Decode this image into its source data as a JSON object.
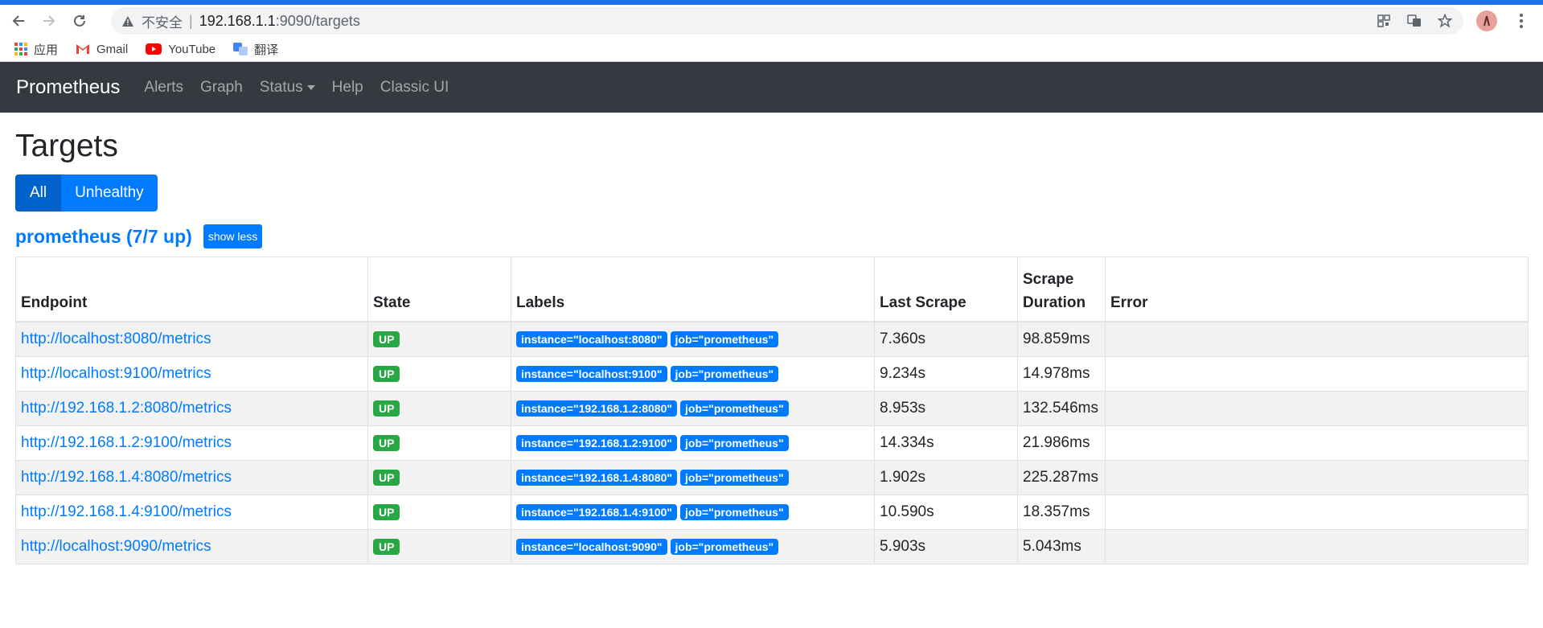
{
  "browser": {
    "insecure_label": "不安全",
    "url_host": "192.168.1.1",
    "url_rest": ":9090/targets",
    "bookmarks": [
      {
        "label": "应用"
      },
      {
        "label": "Gmail"
      },
      {
        "label": "YouTube"
      },
      {
        "label": "翻译"
      }
    ]
  },
  "navbar": {
    "brand": "Prometheus",
    "links": [
      "Alerts",
      "Graph",
      "Status",
      "Help",
      "Classic UI"
    ]
  },
  "page": {
    "title": "Targets",
    "filters": {
      "all": "All",
      "unhealthy": "Unhealthy"
    },
    "job": {
      "title": "prometheus (7/7 up)",
      "toggle_label": "show less"
    }
  },
  "table": {
    "headers": {
      "endpoint": "Endpoint",
      "state": "State",
      "labels": "Labels",
      "last_scrape": "Last Scrape",
      "scrape_duration_1": "Scrape",
      "scrape_duration_2": "Duration",
      "error": "Error"
    },
    "rows": [
      {
        "endpoint": "http://localhost:8080/metrics",
        "state": "UP",
        "instance": "instance=\"localhost:8080\"",
        "job": "job=\"prometheus\"",
        "last_scrape": "7.360s",
        "duration": "98.859ms",
        "error": ""
      },
      {
        "endpoint": "http://localhost:9100/metrics",
        "state": "UP",
        "instance": "instance=\"localhost:9100\"",
        "job": "job=\"prometheus\"",
        "last_scrape": "9.234s",
        "duration": "14.978ms",
        "error": ""
      },
      {
        "endpoint": "http://192.168.1.2:8080/metrics",
        "state": "UP",
        "instance": "instance=\"192.168.1.2:8080\"",
        "job": "job=\"prometheus\"",
        "last_scrape": "8.953s",
        "duration": "132.546ms",
        "error": ""
      },
      {
        "endpoint": "http://192.168.1.2:9100/metrics",
        "state": "UP",
        "instance": "instance=\"192.168.1.2:9100\"",
        "job": "job=\"prometheus\"",
        "last_scrape": "14.334s",
        "duration": "21.986ms",
        "error": ""
      },
      {
        "endpoint": "http://192.168.1.4:8080/metrics",
        "state": "UP",
        "instance": "instance=\"192.168.1.4:8080\"",
        "job": "job=\"prometheus\"",
        "last_scrape": "1.902s",
        "duration": "225.287ms",
        "error": ""
      },
      {
        "endpoint": "http://192.168.1.4:9100/metrics",
        "state": "UP",
        "instance": "instance=\"192.168.1.4:9100\"",
        "job": "job=\"prometheus\"",
        "last_scrape": "10.590s",
        "duration": "18.357ms",
        "error": ""
      },
      {
        "endpoint": "http://localhost:9090/metrics",
        "state": "UP",
        "instance": "instance=\"localhost:9090\"",
        "job": "job=\"prometheus\"",
        "last_scrape": "5.903s",
        "duration": "5.043ms",
        "error": ""
      }
    ]
  },
  "colors": {
    "navbar_bg": "#343a40",
    "link": "#007bff",
    "up_badge": "#28a745",
    "label_badge": "#007bff"
  }
}
